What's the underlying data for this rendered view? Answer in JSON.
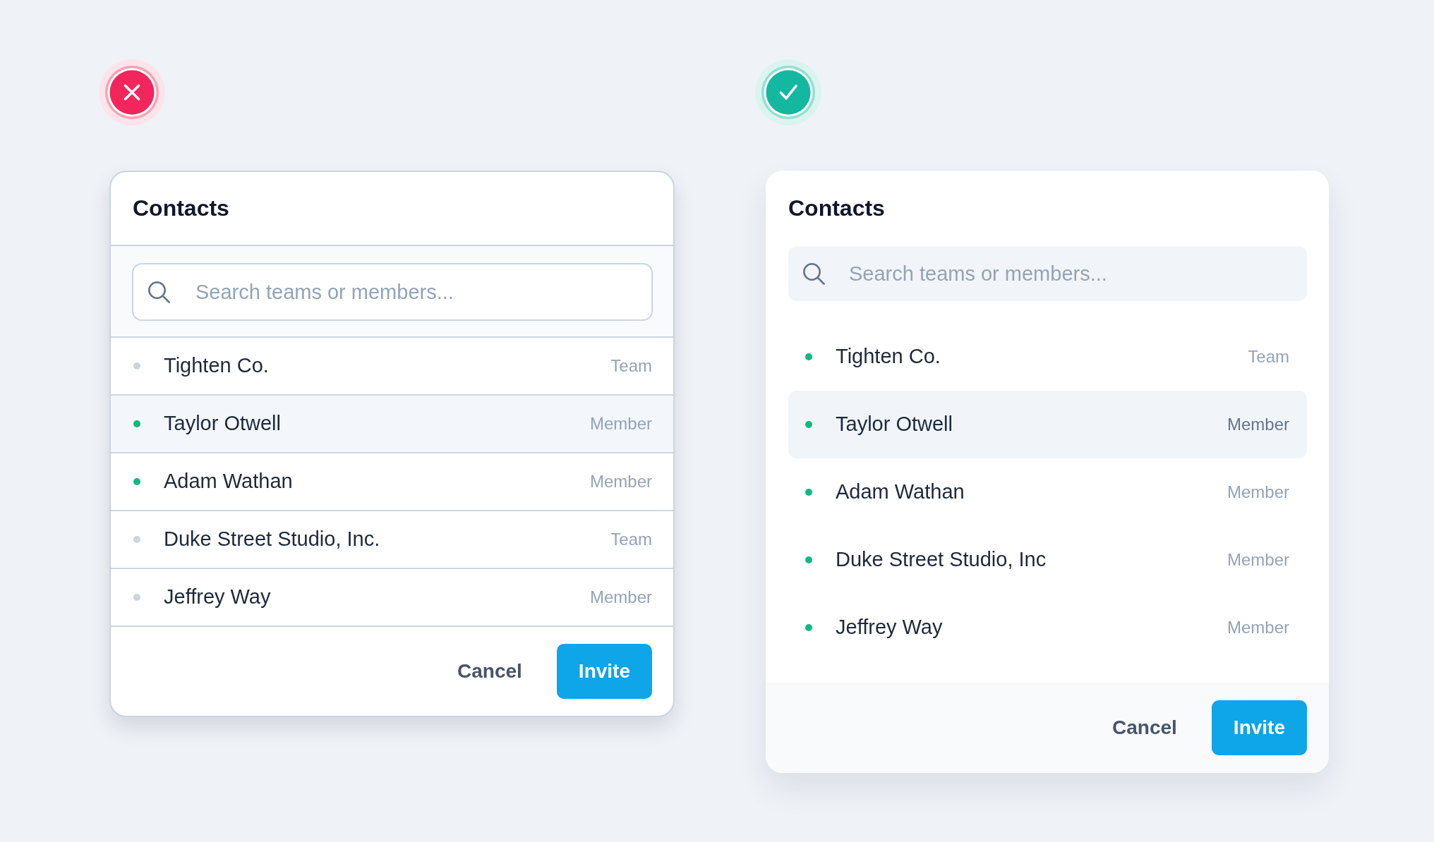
{
  "examples": [
    {
      "kind": "wrong",
      "title": "Contacts",
      "search": {
        "placeholder": "Search teams or members..."
      },
      "contacts": [
        {
          "name": "Tighten Co.",
          "type": "Team",
          "color": "#cbd5e1",
          "selected": false
        },
        {
          "name": "Taylor Otwell",
          "type": "Member",
          "color": "#10b981",
          "selected": true
        },
        {
          "name": "Adam Wathan",
          "type": "Member",
          "color": "#10b981",
          "selected": false
        },
        {
          "name": "Duke Street Studio, Inc.",
          "type": "Team",
          "color": "#cbd5e1",
          "selected": false
        },
        {
          "name": "Jeffrey Way",
          "type": "Member",
          "color": "#cbd5e1",
          "selected": false
        }
      ],
      "buttons": [
        {
          "label": "Cancel",
          "kind": "cancel"
        },
        {
          "label": "Invite",
          "kind": "confirm"
        }
      ]
    },
    {
      "kind": "right",
      "title": "Contacts",
      "search": {
        "placeholder": "Search teams or members..."
      },
      "contacts": [
        {
          "name": "Tighten Co.",
          "type": "Team",
          "color": "#10b981",
          "selected": false
        },
        {
          "name": "Taylor Otwell",
          "type": "Member",
          "color": "#10b981",
          "selected": true
        },
        {
          "name": "Adam Wathan",
          "type": "Member",
          "color": "#10b981",
          "selected": false
        },
        {
          "name": "Duke Street Studio, Inc",
          "type": "Member",
          "color": "#10b981",
          "selected": false
        },
        {
          "name": "Jeffrey Way",
          "type": "Member",
          "color": "#10b981",
          "selected": false
        }
      ],
      "buttons": [
        {
          "label": "Cancel",
          "kind": "cancel"
        },
        {
          "label": "Invite",
          "kind": "confirm"
        }
      ]
    }
  ]
}
